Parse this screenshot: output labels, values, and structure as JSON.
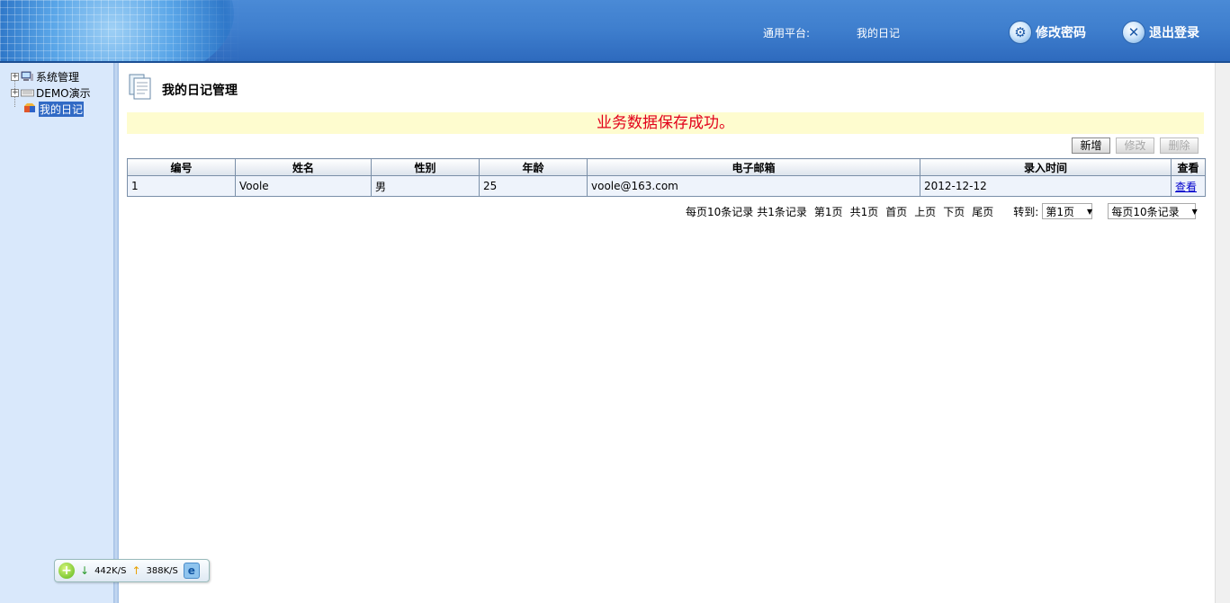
{
  "header": {
    "platform_label": "通用平台:",
    "platform_value": "我的日记",
    "change_password": "修改密码",
    "logout": "退出登录"
  },
  "sidebar": {
    "items": [
      {
        "label": "系统管理"
      },
      {
        "label": "DEMO演示"
      },
      {
        "label": "我的日记",
        "selected": true
      }
    ]
  },
  "main": {
    "title": "我的日记管理",
    "message": "业务数据保存成功。",
    "buttons": {
      "add": "新增",
      "edit": "修改",
      "delete": "删除"
    },
    "table": {
      "headers": [
        "编号",
        "姓名",
        "性别",
        "年龄",
        "电子邮箱",
        "录入时间",
        "查看"
      ],
      "rows": [
        [
          "1",
          "Voole",
          "男",
          "25",
          "voole@163.com",
          "2012-12-12",
          "查看"
        ]
      ]
    },
    "pager": {
      "per_page_text": "每页10条记录",
      "total_text": "共1条记录",
      "current_page": "第1页",
      "total_pages": "共1页",
      "first": "首页",
      "prev": "上页",
      "next": "下页",
      "last": "尾页",
      "goto_label": "转到:",
      "goto_value": "第1页",
      "per_page_value": "每页10条记录"
    }
  },
  "net_widget": {
    "down_speed": "442K/S",
    "up_speed": "388K/S"
  },
  "colors": {
    "header_blue": "#3f7fce",
    "sidebar_bg": "#d9e8fb",
    "message_bg": "#fefccf",
    "message_text": "#e2001a",
    "selected": "#316ac5"
  }
}
